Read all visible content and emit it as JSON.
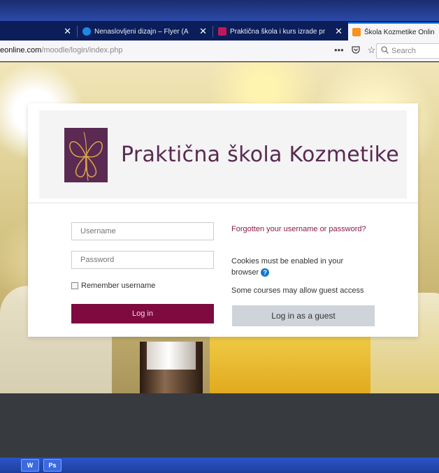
{
  "tabs": [
    {
      "label": "",
      "active": false
    },
    {
      "label": "Nenaslovljeni dizajn – Flyer (A",
      "active": false,
      "icon": "google-icon"
    },
    {
      "label": "Praktična škola i kurs izrade pr",
      "active": false,
      "icon": "butterfly-icon"
    },
    {
      "label": "Škola Kozmetike Onlin",
      "active": true,
      "icon": "moodle-icon"
    }
  ],
  "address": {
    "host": "eonline.com",
    "path": "/moodle/login/index.php"
  },
  "search": {
    "placeholder": "Search"
  },
  "brand": {
    "name": "Praktična škola Kozmetike",
    "color": "#5a2a52"
  },
  "login": {
    "username_placeholder": "Username",
    "password_placeholder": "Password",
    "remember_label": "Remember username",
    "login_button": "Log in",
    "forgot_link": "Forgotten your username or password?",
    "cookies_notice": "Cookies must be enabled in your browser",
    "guest_notice": "Some courses may allow guest access",
    "guest_button": "Log in as a guest"
  },
  "colors": {
    "login_button": "#7e0a40",
    "guest_button": "#ced4da",
    "link": "#8b1a4a",
    "tab_bar": "#0b1e5a"
  }
}
